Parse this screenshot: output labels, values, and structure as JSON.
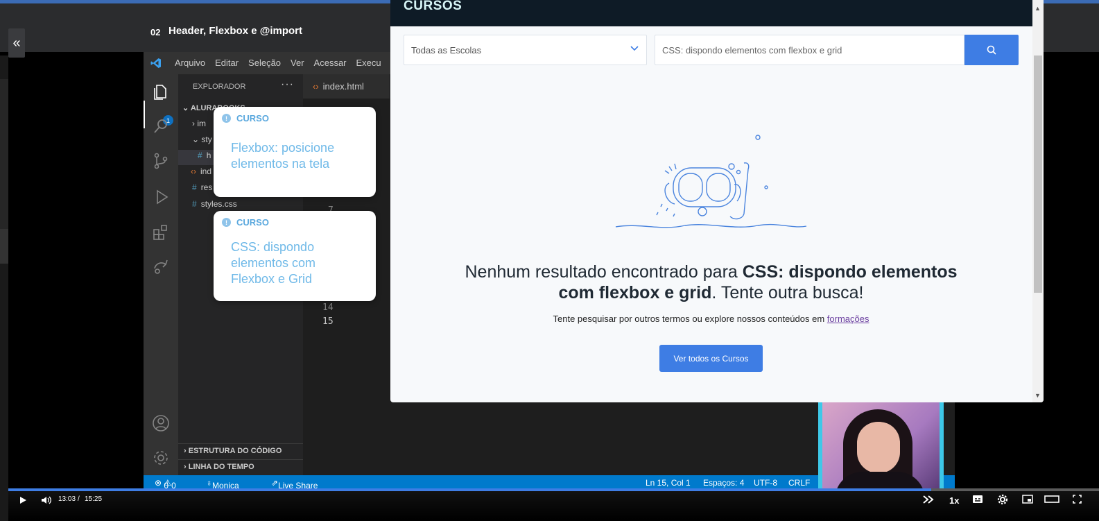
{
  "lesson": {
    "number": "02",
    "title": "Header, Flexbox e @import"
  },
  "vscode": {
    "menu": [
      "Arquivo",
      "Editar",
      "Seleção",
      "Ver",
      "Acessar",
      "Execu"
    ],
    "explorer_title": "EXPLORADOR",
    "project": "ALURABOOKS",
    "tree": [
      {
        "label": "im"
      },
      {
        "label": "sty"
      },
      {
        "label": "h"
      },
      {
        "label": "ind"
      },
      {
        "label": "res"
      },
      {
        "label": "styles.css"
      }
    ],
    "sections": [
      "ESTRUTURA DO CÓDIGO",
      "LINHA DO TEMPO"
    ],
    "tab": "index.html",
    "line_numbers": [
      "7",
      "14",
      "15"
    ],
    "badge_count": "1",
    "status": {
      "errors": "0",
      "warnings": "0",
      "user": "Monica",
      "liveshare": "Live Share",
      "position": "Ln 15, Col 1",
      "spaces": "Espaços: 4",
      "encoding": "UTF-8",
      "eol": "CRLF"
    }
  },
  "course_cards": [
    {
      "tag": "CURSO",
      "title": "Flexbox: posicione elementos na tela"
    },
    {
      "tag": "CURSO",
      "title": "CSS: dispondo elementos com Flexbox e Grid"
    }
  ],
  "modal": {
    "heading": "CURSOS",
    "school_select": "Todas as Escolas",
    "search_value": "CSS: dispondo elementos com flexbox e grid",
    "no_result_prefix": "Nenhum resultado encontrado para ",
    "no_result_query": "CSS: dispondo elementos com flexbox e grid",
    "no_result_suffix": ". Tente outra busca!",
    "hint_text": "Tente pesquisar por outros termos ou explore nossos conteúdos em ",
    "hint_link": "formações",
    "view_all_button": "Ver todos os Cursos"
  },
  "player": {
    "time_current": "13:03",
    "time_separator": "/",
    "time_total": "15:25",
    "speed": "1x",
    "progress_fraction": 0.846
  },
  "colors": {
    "accent": "#3e7de4",
    "vscode_status": "#007acc",
    "modal_header": "#0e1b26"
  }
}
